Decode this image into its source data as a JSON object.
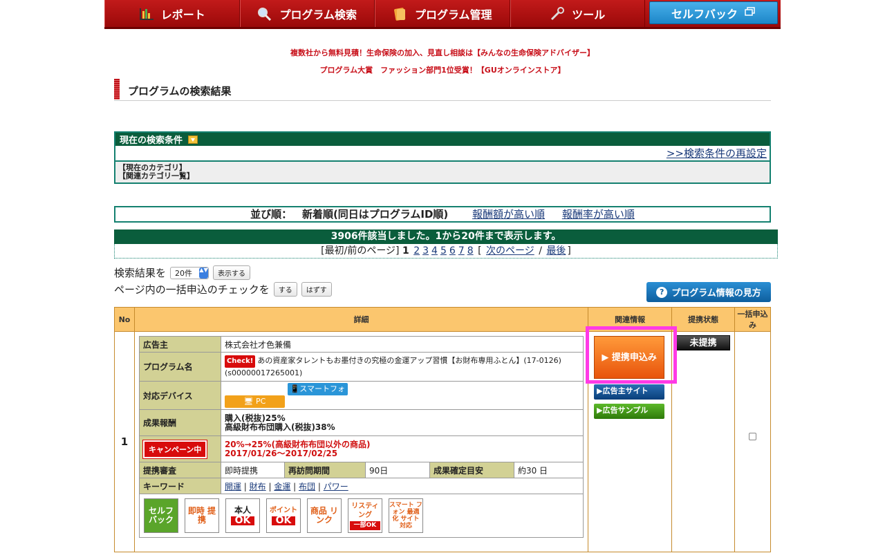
{
  "nav": {
    "report": "レポート",
    "search": "プログラム検索",
    "manage": "プログラム管理",
    "tools": "ツール",
    "selfback": "セルフバック"
  },
  "promos": [
    "複数社から無料見積！生命保険の加入、見直し相談は【みんなの生命保険アドバイザー】",
    "プログラム大賞　ファッション部門1位受賞！【GUオンラインストア】"
  ],
  "page_title": "プログラムの検索結果",
  "conditions": {
    "header": "現在の検索条件",
    "reset_link": ">>検索条件の再設定",
    "current_category": "【現在のカテゴリ】",
    "related_category": "【関連カテゴリ一覧】"
  },
  "sort": {
    "label": "並び順：",
    "current": "新着順(同日はプログラムID順)",
    "option1": "報酬額が高い順",
    "option2": "報酬率が高い順"
  },
  "results": {
    "summary": "3906件該当しました。1から20件まで表示します。",
    "pager_first_prev": "[最初/前のページ]",
    "current_page": "1",
    "pages": [
      "2",
      "3",
      "4",
      "5",
      "6",
      "7",
      "8"
    ],
    "bracket_open": "[",
    "next": "次のページ",
    "slash": "/",
    "last": "最後",
    "bracket_close": "]"
  },
  "controls": {
    "results_label": "検索結果を",
    "per_page": "20件",
    "show_button": "表示する",
    "bulk_label": "ページ内の一括申込のチェックを",
    "check_button": "する",
    "uncheck_button": "はずす",
    "howto_button": "プログラム情報の見方"
  },
  "table": {
    "headers": [
      "No",
      "詳細",
      "関連情報",
      "提携状態",
      "一括申込み"
    ],
    "row1": {
      "no": "1",
      "advertiser_label": "広告主",
      "advertiser": "株式会社才色兼備",
      "program_label": "プログラム名",
      "check_badge": "Check!",
      "program_name": "あの資産家タレントもお墨付きの究極の金運アップ習慣【お財布専用ふとん】(17-0126)(s00000017265001)",
      "device_label": "対応デバイス",
      "device_pc": "PC",
      "device_sp": "スマートフォン",
      "reward_label": "成果報酬",
      "reward1": "購入(税抜)25%",
      "reward2": "高級財布布団購入(税抜)38%",
      "campaign_badge": "キャンペーン中",
      "campaign1": "20%→25%(高級財布布団以外の商品)",
      "campaign2": "2017/01/26～2017/02/25",
      "review_label": "提携審査",
      "review": "即時提携",
      "revisit_label": "再訪問期間",
      "revisit": "90日",
      "confirm_label": "成果確定目安",
      "confirm": "約30 日",
      "keyword_label": "キーワード",
      "keywords": [
        "開運",
        "財布",
        "金運",
        "布団",
        "パワー"
      ],
      "badges": {
        "selfback": "セルフ バック",
        "instant": "即時 提携",
        "self_top": "本人",
        "ok": "OK",
        "point_top": "ポイント",
        "product": "商品 リンク",
        "listing": "リスティ ング",
        "partial_ok": "一部OK",
        "smartphone": "スマート フォン 最適化 サイト対応"
      },
      "apply_button": "提携申込み",
      "advertiser_site": "広告主サイト",
      "ad_sample": "広告サンプル",
      "status": "未提携"
    }
  },
  "colors": {
    "nav_red": "#b01010",
    "accent_green": "#0a5d3c",
    "table_orange": "#fbc66e",
    "highlight": "#ff3ae6"
  }
}
